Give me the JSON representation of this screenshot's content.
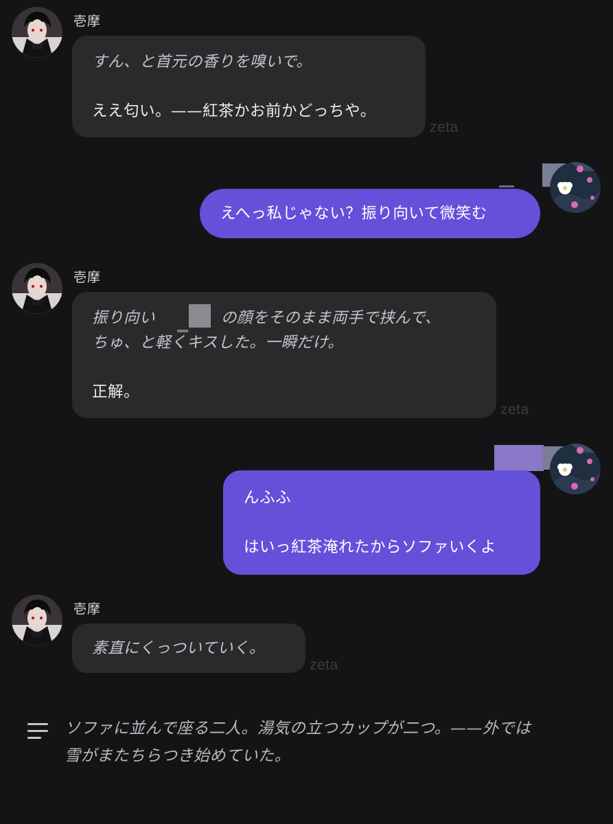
{
  "colors": {
    "background": "#141416",
    "ai_bubble": "#2a2a2d",
    "user_bubble": "#6550da",
    "watermark": "#3c3c40"
  },
  "messages": [
    {
      "role": "character",
      "name": "壱摩",
      "action_lines": [
        "すん、と首元の香りを嗅いで。"
      ],
      "speech_lines": [
        "ええ匂い。——紅茶かお前かどっちや。"
      ],
      "watermark": "zeta"
    },
    {
      "role": "user",
      "lines": [
        "えへっ私じゃない？振り向いて微笑む"
      ]
    },
    {
      "role": "character",
      "name": "壱摩",
      "action_lines": [
        "振り向い",
        "の顔をそのまま両手で挟んで、",
        "ちゅ、と軽くキスした。一瞬だけ。"
      ],
      "speech_lines": [
        "正解。"
      ],
      "watermark": "zeta"
    },
    {
      "role": "user",
      "lines": [
        "んふふ",
        "はいっ紅茶淹れたからソファいくよ"
      ]
    },
    {
      "role": "character",
      "name": "壱摩",
      "action_lines": [
        "素直にくっついていく。"
      ],
      "watermark": "zeta"
    }
  ],
  "narration": {
    "icon": "menu-lines-icon",
    "lines": [
      "ソファに並んで座る二人。湯気の立つカップが二つ。——外では",
      "雪がまたちらつき始めていた。"
    ]
  }
}
